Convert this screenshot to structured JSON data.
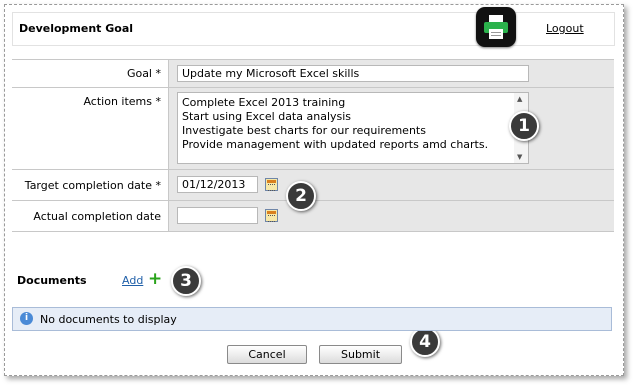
{
  "header": {
    "title": "Development Goal",
    "print_icon": "printer-icon",
    "logout_label": "Logout"
  },
  "form": {
    "goal_label": "Goal *",
    "goal_value": "Update my Microsoft Excel skills",
    "action_items_label": "Action items *",
    "action_items": [
      "Complete Excel 2013 training",
      "Start using Excel data analysis",
      "Investigate best charts for our requirements",
      "Provide management with updated reports amd charts."
    ],
    "target_date_label": "Target completion date *",
    "target_date_value": "01/12/2013",
    "actual_date_label": "Actual completion date",
    "actual_date_value": ""
  },
  "documents": {
    "label": "Documents",
    "add_label": "Add",
    "empty_message": "No documents to display"
  },
  "buttons": {
    "cancel": "Cancel",
    "submit": "Submit"
  },
  "callouts": [
    "1",
    "2",
    "3",
    "4"
  ],
  "colors": {
    "field_bg": "#e7e7e7",
    "info_bg": "#e6edf7",
    "link": "#1f5fa8",
    "add_green": "#2aa31b",
    "callout": "#3a3a3a"
  }
}
